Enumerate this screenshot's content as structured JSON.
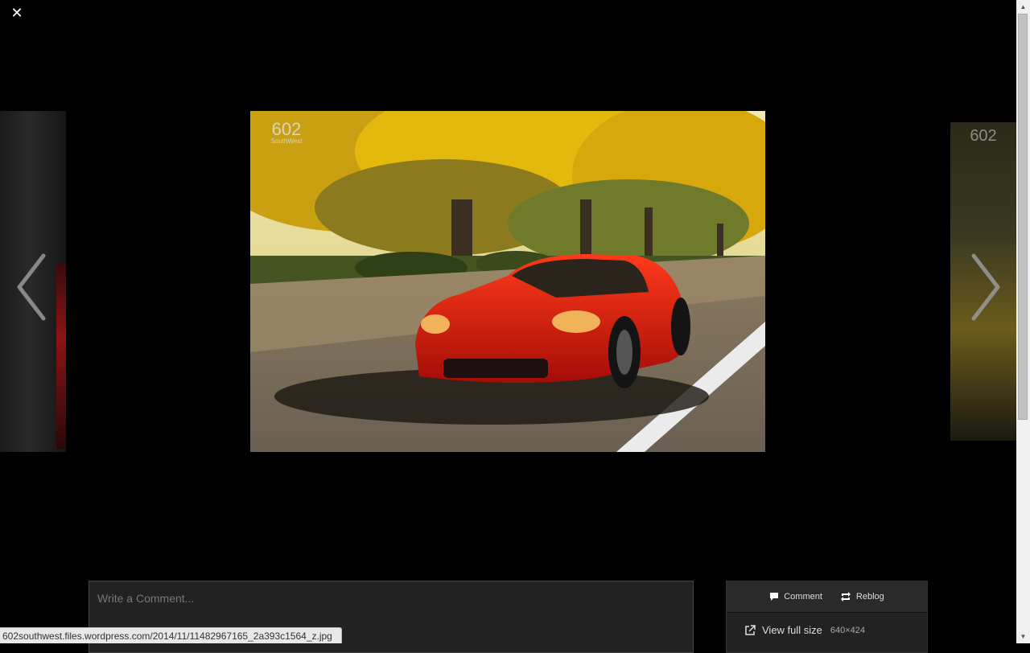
{
  "lightbox": {
    "close_icon": "close-icon",
    "close_glyph": "✕",
    "prev_icon": "chevron-left-icon",
    "next_icon": "chevron-right-icon",
    "photo_watermark": "602",
    "photo_watermark_sub": "SouthWest",
    "side_watermark": "602"
  },
  "comment": {
    "placeholder": "Write a Comment..."
  },
  "actions": {
    "comment_label": "Comment",
    "reblog_label": "Reblog",
    "view_full_label": "View full size",
    "dimensions": "640×424"
  },
  "status": {
    "url": "602southwest.files.wordpress.com/2014/11/11482967165_2a393c1564_z.jpg"
  },
  "colors": {
    "background": "#000000",
    "panel": "#222222",
    "car_red": "#d11a0f",
    "foliage": "#e6b800"
  }
}
